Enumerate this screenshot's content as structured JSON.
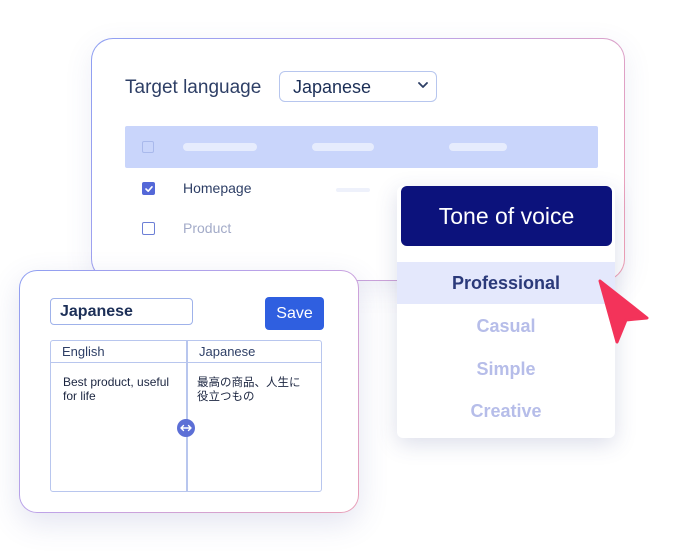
{
  "settings_card": {
    "target_language_label": "Target language",
    "language_select": {
      "selected": "Japanese"
    },
    "rows": [
      {
        "label": "Homepage",
        "checked": true
      },
      {
        "label": "Product",
        "checked": false
      }
    ]
  },
  "tone_dropdown": {
    "title": "Tone of voice",
    "options": [
      {
        "label": "Professional",
        "selected": true
      },
      {
        "label": "Casual",
        "selected": false
      },
      {
        "label": "Simple",
        "selected": false
      },
      {
        "label": "Creative",
        "selected": false
      }
    ]
  },
  "editor_card": {
    "language_field": {
      "value": "Japanese"
    },
    "save_label": "Save",
    "source_column": {
      "header": "English",
      "text": "Best product, useful for life"
    },
    "target_column": {
      "header": "Japanese",
      "text": "最高の商品、人生に役立つもの"
    }
  },
  "colors": {
    "brand_navy": "#0c127c",
    "primary_button": "#2f5fe0",
    "cursor_red": "#f3335a",
    "highlight": "#e4e8fc"
  },
  "icons": [
    "chevron-down-icon",
    "checkbox-checked-icon",
    "checkbox-empty-icon",
    "swap-arrows-icon",
    "pointer-cursor-icon"
  ]
}
